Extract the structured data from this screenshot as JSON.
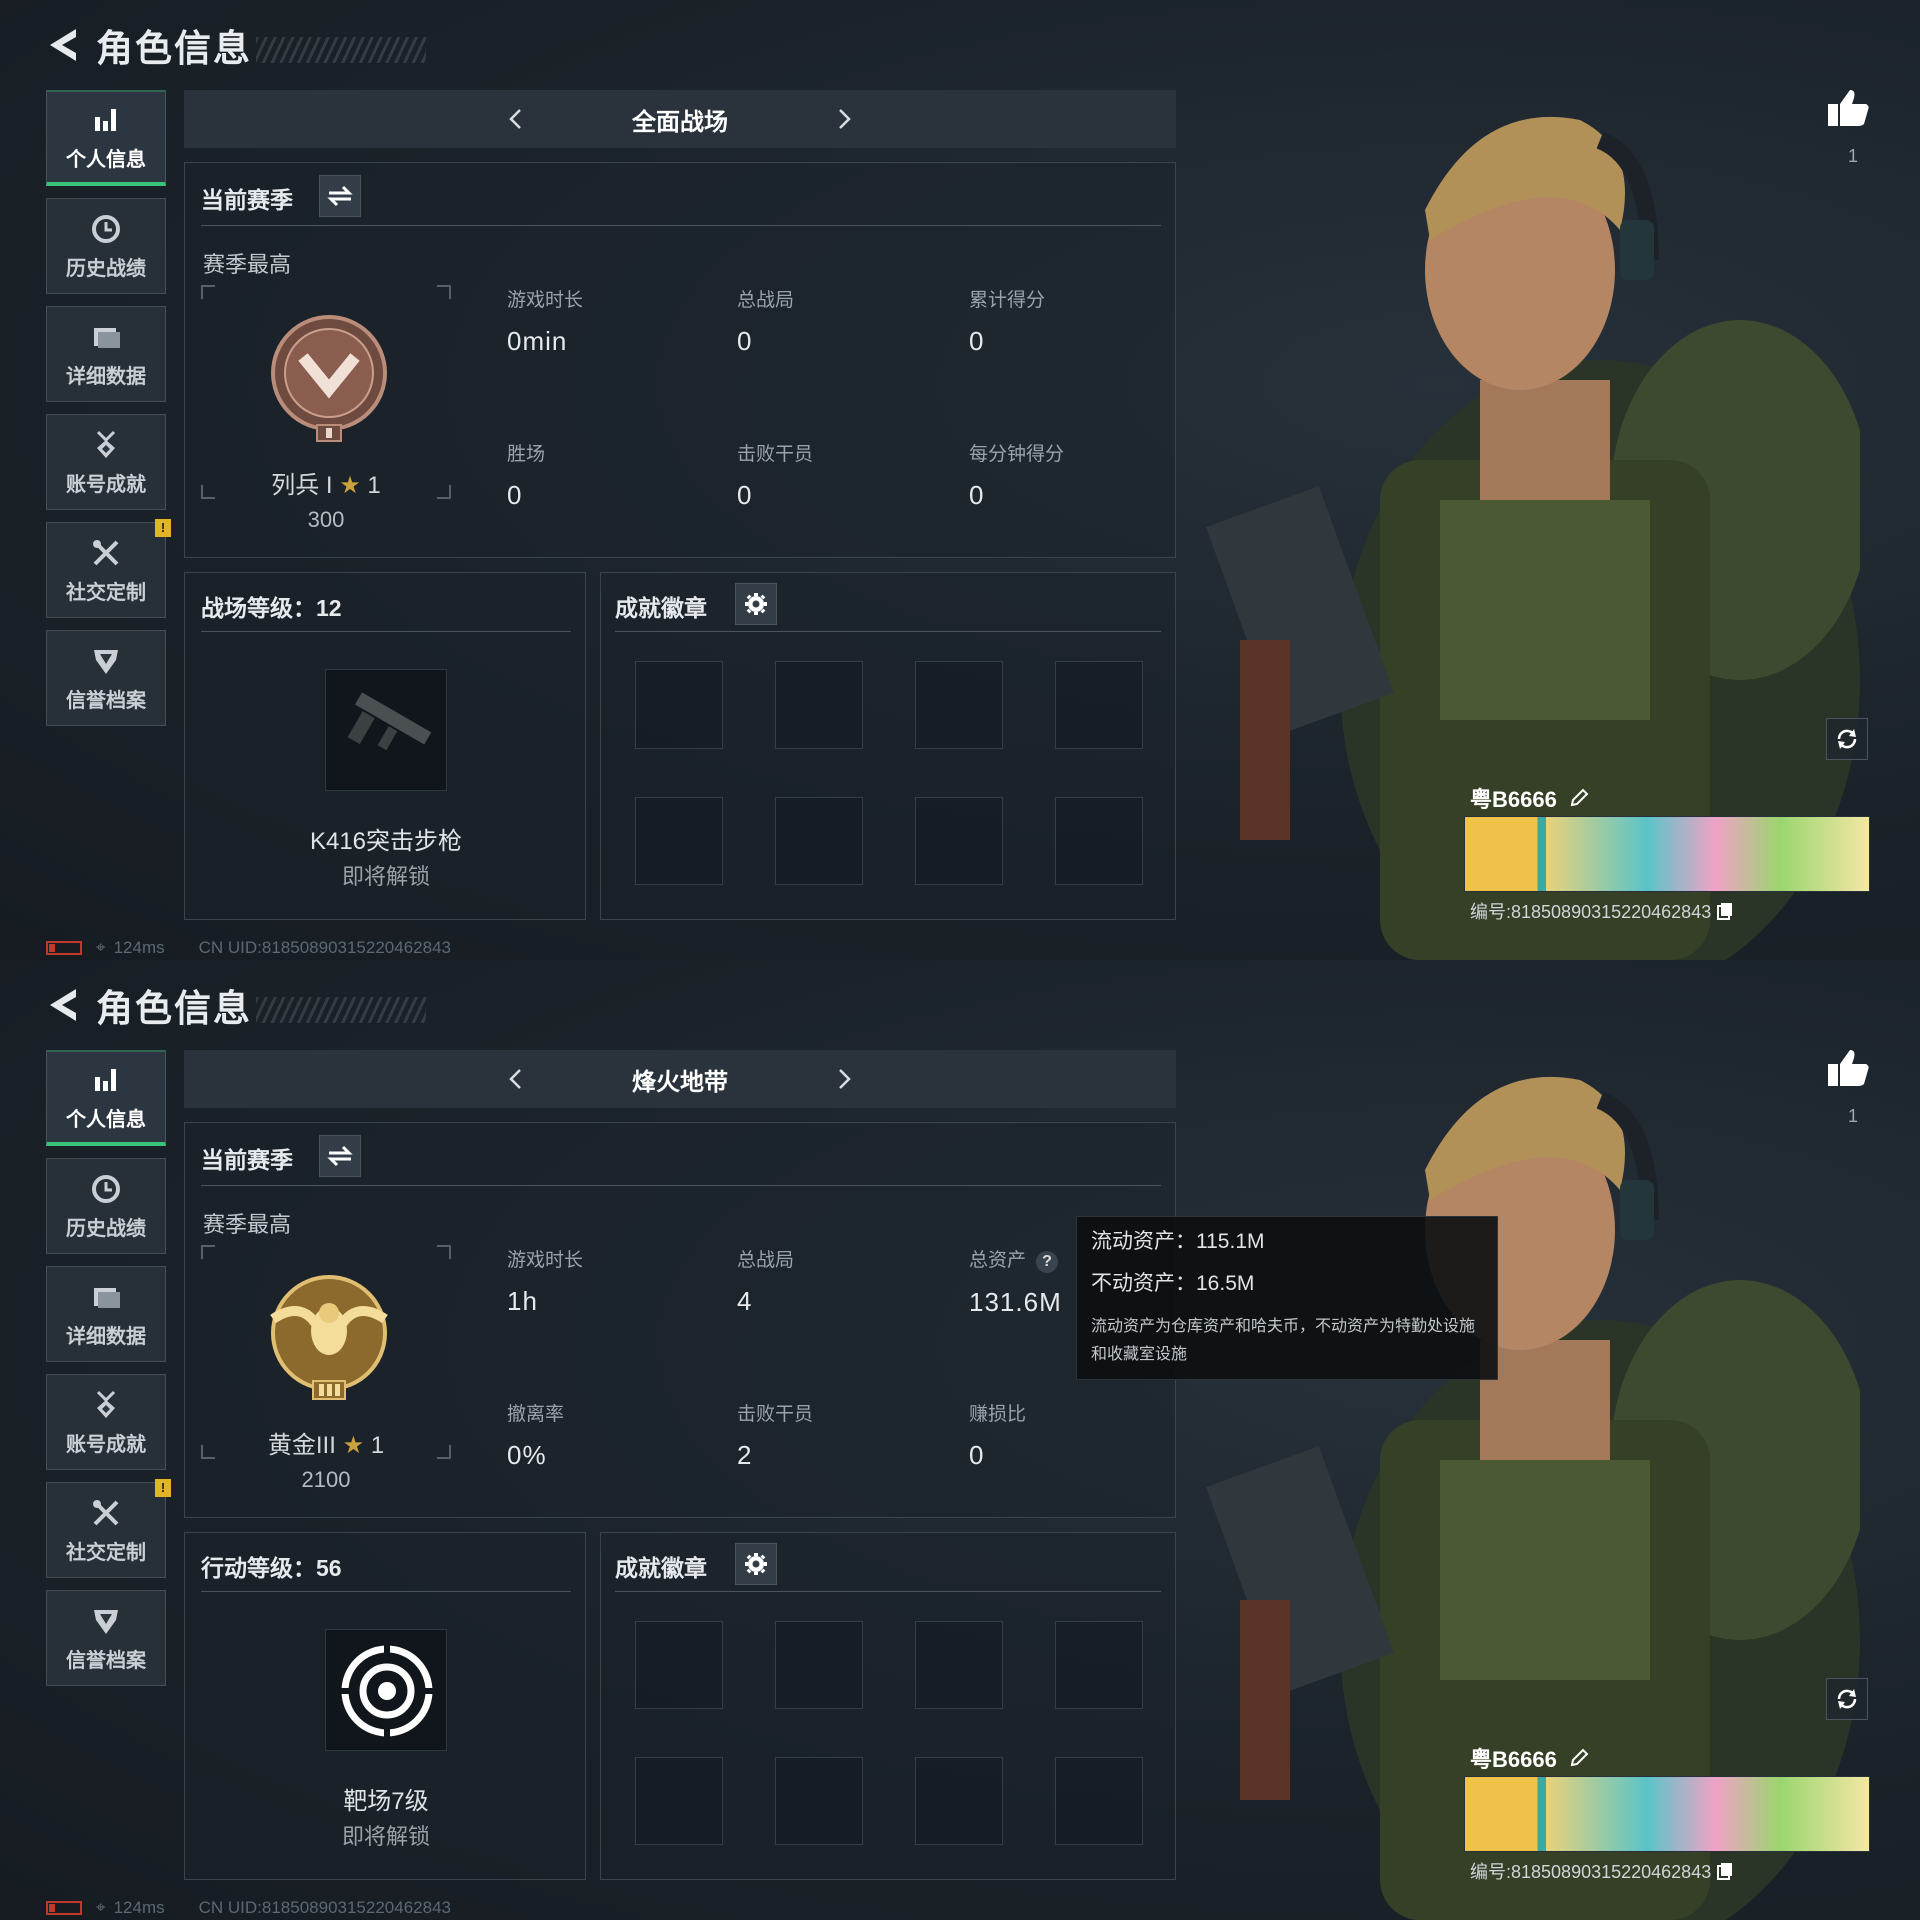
{
  "screens": [
    {
      "header": {
        "title": "角色信息"
      },
      "sidebar": [
        {
          "label": "个人信息",
          "icon": "bar-chart-icon",
          "active": true
        },
        {
          "label": "历史战绩",
          "icon": "history-clock-icon"
        },
        {
          "label": "详细数据",
          "icon": "folder-icon"
        },
        {
          "label": "账号成就",
          "icon": "medal-icon"
        },
        {
          "label": "社交定制",
          "icon": "tools-icon",
          "badge": "!"
        },
        {
          "label": "信誉档案",
          "icon": "shield-icon"
        }
      ],
      "mode": {
        "name": "全面战场"
      },
      "season": {
        "title": "当前赛季",
        "subtitle": "赛季最高",
        "rank_name": "列兵 I",
        "rank_stars": "1",
        "rank_score": "300",
        "stats": [
          {
            "label": "游戏时长",
            "value": "0min"
          },
          {
            "label": "总战局",
            "value": "0"
          },
          {
            "label": "累计得分",
            "value": "0"
          },
          {
            "label": "胜场",
            "value": "0"
          },
          {
            "label": "击败干员",
            "value": "0"
          },
          {
            "label": "每分钟得分",
            "value": "0"
          }
        ]
      },
      "level": {
        "title": "战场等级：12",
        "item_name": "K416突击步枪",
        "item_status": "即将解锁"
      },
      "badges": {
        "title": "成就徽章"
      },
      "status": {
        "latency": "124ms",
        "uid": "CN UID:8185089031522046284​3"
      },
      "player": {
        "name": "粤B6666",
        "id": "编号:8185089031522046284​3",
        "likes": "1"
      }
    },
    {
      "header": {
        "title": "角色信息"
      },
      "sidebar": [
        {
          "label": "个人信息",
          "icon": "bar-chart-icon",
          "active": true
        },
        {
          "label": "历史战绩",
          "icon": "history-clock-icon"
        },
        {
          "label": "详细数据",
          "icon": "folder-icon"
        },
        {
          "label": "账号成就",
          "icon": "medal-icon"
        },
        {
          "label": "社交定制",
          "icon": "tools-icon",
          "badge": "!"
        },
        {
          "label": "信誉档案",
          "icon": "shield-icon"
        }
      ],
      "mode": {
        "name": "烽火地带"
      },
      "season": {
        "title": "当前赛季",
        "subtitle": "赛季最高",
        "rank_name": "黄金III",
        "rank_stars": "1",
        "rank_score": "2100",
        "stats": [
          {
            "label": "游戏时长",
            "value": "1h"
          },
          {
            "label": "总战局",
            "value": "4"
          },
          {
            "label": "总资产",
            "value": "131.6M",
            "help": "?"
          },
          {
            "label": "撤离率",
            "value": "0%"
          },
          {
            "label": "击败干员",
            "value": "2"
          },
          {
            "label": "赚损比",
            "value": "0"
          }
        ]
      },
      "tooltip": {
        "liquid": "流动资产：115.1M",
        "fixed": "不动资产：16.5M",
        "note": "流动资产为仓库资产和哈夫币，不动资产为特勤处设施和收藏室设施"
      },
      "level": {
        "title": "行动等级：56",
        "item_name": "靶场7级",
        "item_status": "即将解锁"
      },
      "badges": {
        "title": "成就徽章"
      },
      "status": {
        "latency": "124ms",
        "uid": "CN UID:8185089031522046284​3"
      },
      "player": {
        "name": "粤B6666",
        "id": "编号:8185089031522046284​3",
        "likes": "1"
      }
    }
  ]
}
